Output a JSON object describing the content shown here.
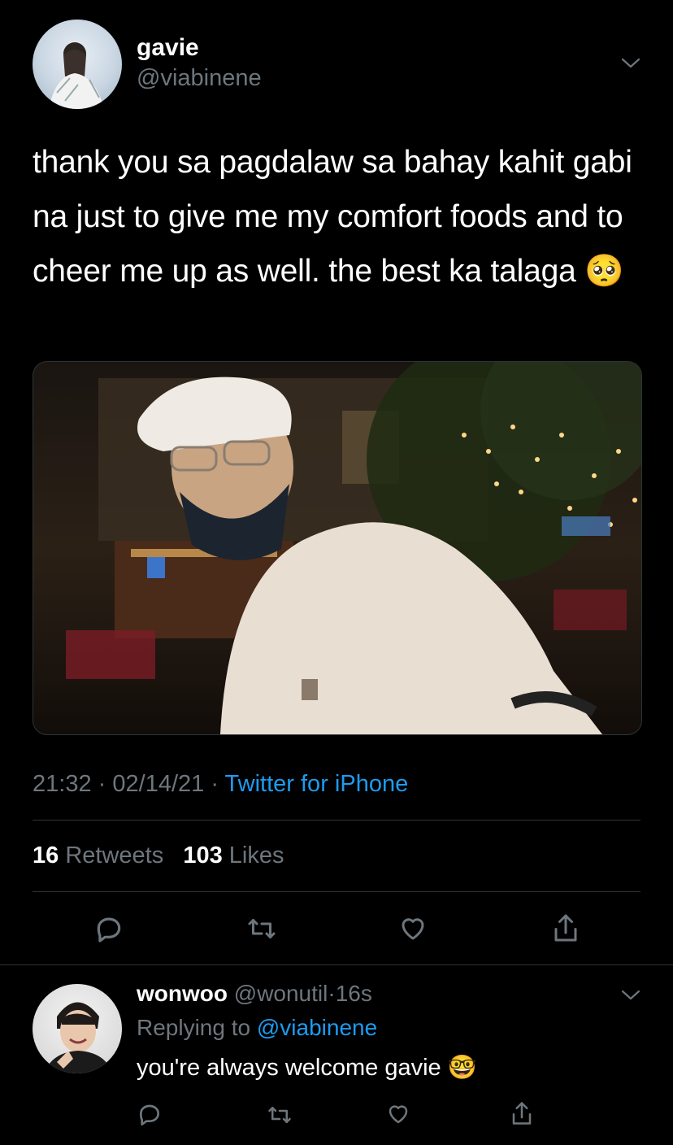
{
  "tweet": {
    "author_name": "gavie",
    "author_handle": "@viabinene",
    "text": "thank you sa pagdalaw sa bahay kahit gabi na just to give me my comfort foods and to cheer me up as well. the best ka talaga 🥺",
    "time": "21:32",
    "date": "02/14/21",
    "separator": "·",
    "source": "Twitter for iPhone",
    "retweets_count": "16",
    "retweets_label": "Retweets",
    "likes_count": "103",
    "likes_label": "Likes"
  },
  "reply": {
    "author_name": "wonwoo",
    "author_handle": "@wonutil",
    "separator": "·",
    "time_ago": "16s",
    "replying_to_label": "Replying to",
    "replying_to_handle": "@viabinene",
    "text": "you're always welcome gavie 🤓"
  },
  "icons": {
    "reply": "reply-icon",
    "retweet": "retweet-icon",
    "like": "heart-icon",
    "share": "share-icon",
    "more": "chevron-down-icon"
  },
  "colors": {
    "background": "#000000",
    "link": "#1d9bf0",
    "muted": "#6e767d",
    "divider": "#2f3336"
  }
}
